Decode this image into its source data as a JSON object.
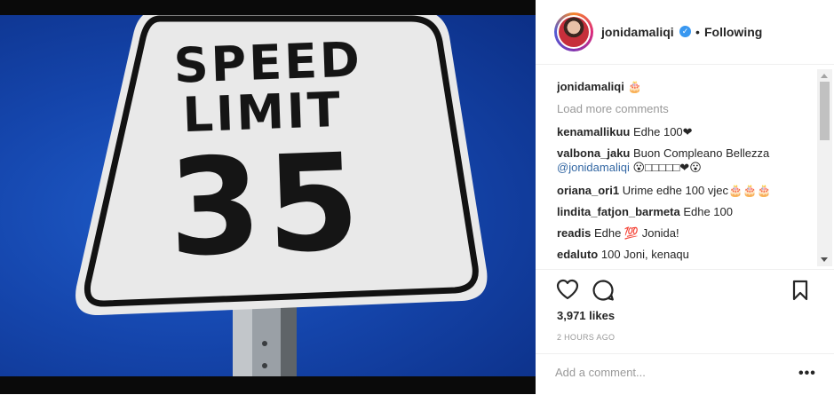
{
  "post": {
    "image": {
      "sign_line1": "SPEED",
      "sign_line2": "LIMIT",
      "sign_number": "35"
    }
  },
  "header": {
    "username": "jonidamaliqi",
    "verified_icon": "verified-badge-icon",
    "separator": "•",
    "follow_status": "Following"
  },
  "comments": {
    "caption": {
      "user": "jonidamaliqi",
      "text": "🎂"
    },
    "load_more": "Load more comments",
    "items": [
      {
        "user": "kenamallikuu",
        "text": "Edhe 100❤"
      },
      {
        "user": "valbona_jaku",
        "text": "Buon Compleano Bellezza",
        "mention": "@jonidamaliqi",
        "text2": "😮□□□□□❤😮"
      },
      {
        "user": "oriana_ori1",
        "text": "Urime edhe 100 vjec🎂🎂🎂"
      },
      {
        "user": "lindita_fatjon_barmeta",
        "text": "Edhe 100"
      },
      {
        "user": "readis",
        "text": "Edhe 💯 Jonida!"
      },
      {
        "user": "edaluto",
        "text": "100 Joni, kenaqu"
      }
    ]
  },
  "actions": {
    "like_icon": "heart-icon",
    "comment_icon": "comment-icon",
    "save_icon": "bookmark-icon"
  },
  "likes": "3,971 likes",
  "timestamp": "2 HOURS AGO",
  "add_comment": {
    "placeholder": "Add a comment..."
  },
  "more_options": "•••",
  "colors": {
    "link": "#3367a3",
    "verified": "#3897f0",
    "text": "#262626",
    "muted": "#999999"
  }
}
